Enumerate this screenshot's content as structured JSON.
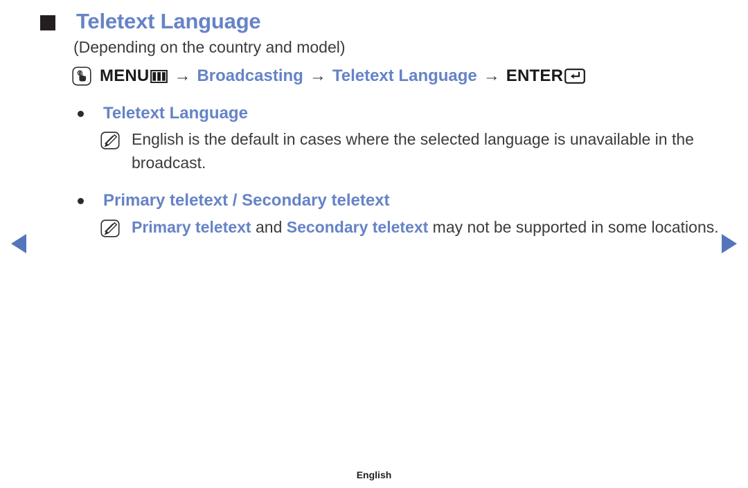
{
  "header": {
    "square_bullet": "black-square",
    "title": "Teletext Language",
    "subtitle": "(Depending on the country and model)"
  },
  "menu_path": {
    "touch_icon": "touch-hand-icon",
    "menu_label": "MENU",
    "menu_icon": "menu-grid-icon",
    "arrow": "→",
    "step_broadcasting": "Broadcasting",
    "step_teletext_language": "Teletext Language",
    "enter_label": "ENTER",
    "enter_icon": "enter-return-icon"
  },
  "sections": [
    {
      "bullet": "dot",
      "label": "Teletext Language",
      "note_icon": "note-pencil-icon",
      "note_parts": [
        {
          "text": "English is the default in cases where the selected language is unavailable in the broadcast.",
          "highlight": false
        }
      ]
    },
    {
      "bullet": "dot",
      "label": "Primary teletext / Secondary teletext",
      "note_icon": "note-pencil-icon",
      "note_parts": [
        {
          "text": "Primary teletext",
          "highlight": true
        },
        {
          "text": " and ",
          "highlight": false
        },
        {
          "text": "Secondary teletext",
          "highlight": true
        },
        {
          "text": " may not be supported in some locations.",
          "highlight": false
        }
      ]
    }
  ],
  "navigation": {
    "prev_icon": "left-triangle-icon",
    "next_icon": "right-triangle-icon"
  },
  "footer": {
    "language": "English"
  },
  "colors": {
    "accent_blue": "#6583c7",
    "arrow_blue": "#5575bb",
    "text_dark": "#3b3b3b",
    "bullet_black": "#231f20"
  }
}
